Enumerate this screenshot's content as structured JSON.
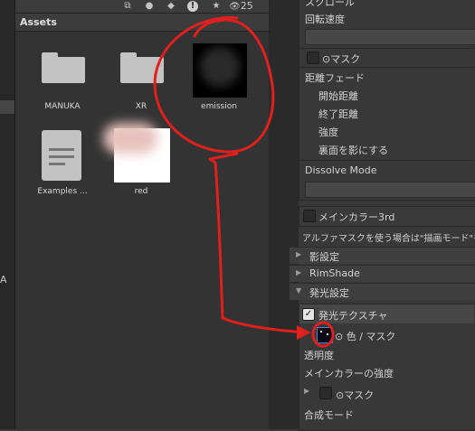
{
  "toolbar": {
    "hidden_count": "25"
  },
  "left": {
    "letter": "A"
  },
  "assets": {
    "title": "Assets",
    "items": [
      {
        "label": "MANUKA"
      },
      {
        "label": "XR"
      },
      {
        "label": "emission"
      },
      {
        "label": "Examples ..."
      },
      {
        "label": "red"
      }
    ]
  },
  "inspector": {
    "scroll_label": "スクロール",
    "rotation_speed": "回転速度",
    "mask1": "⊙マスク",
    "distance_fade": "距離フェード",
    "fade_start": "開始距離",
    "fade_end": "終了距離",
    "strength": "強度",
    "backface_shadow": "裏面を影にする",
    "dissolve_mode": "Dissolve Mode",
    "main_color3": "メインカラー3rd",
    "alpha_mask_note": "アルファマスクを使う場合は\"描画モード\"を",
    "shadow_settings": "影設定",
    "rimshade": "RimShade",
    "emission_settings": "発光設定",
    "emission_texture": "発光テクスチャ",
    "color_mask": "⊙ 色 / マスク",
    "transparency": "透明度",
    "main_color_strength": "メインカラーの強度",
    "mask2": "⊙マスク",
    "blend_mode": "合成モード"
  },
  "annotation": {
    "color": "#e01f1f"
  }
}
